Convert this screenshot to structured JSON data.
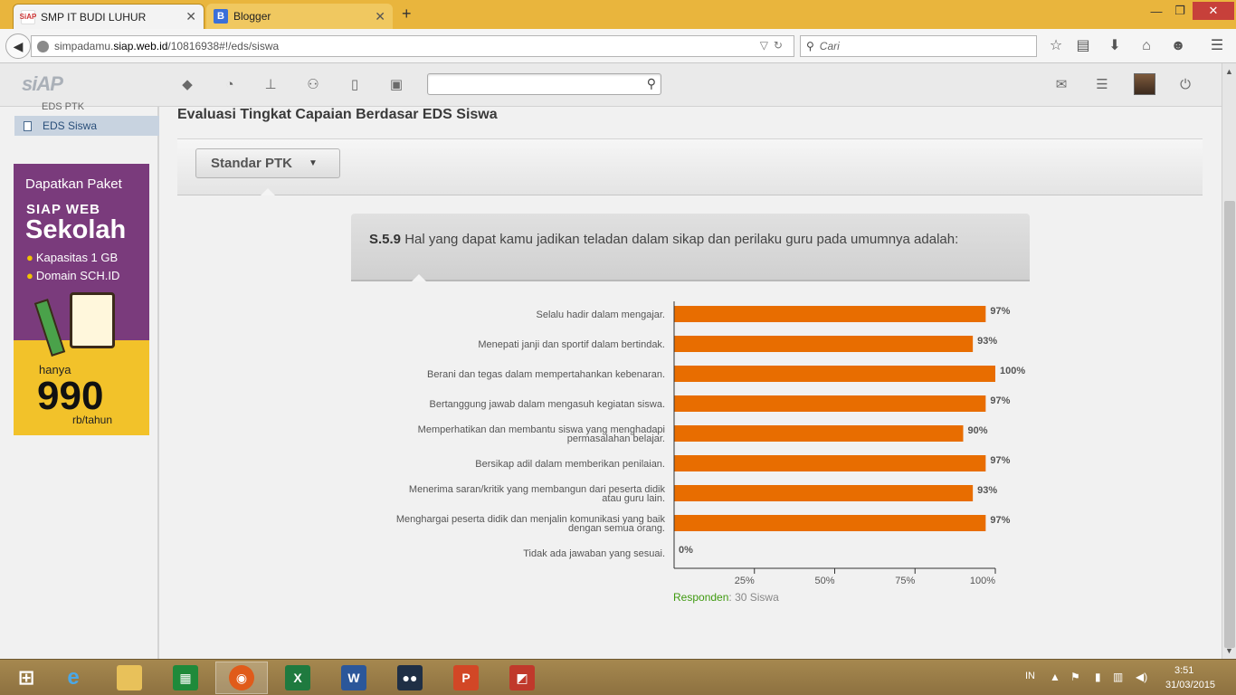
{
  "browser": {
    "tabs": [
      {
        "title": "SMP IT BUDI LUHUR",
        "active": true,
        "favicon": "siap-favicon"
      },
      {
        "title": "Blogger",
        "active": false,
        "favicon": "blogger-favicon"
      }
    ],
    "new_tab": "+",
    "close_glyph": "✕",
    "url_prefix": "simpadamu.",
    "url_domain": "siap.web.id",
    "url_path": "/10816938#!/eds/siswa",
    "search_placeholder": "Cari",
    "accent_color": "#e9b53d"
  },
  "app": {
    "logo": "siAP",
    "header_icons": [
      "cube-icon",
      "rss-icon",
      "sitemap-icon",
      "users-icon",
      "book-icon",
      "contact-card-icon"
    ],
    "search_placeholder": ""
  },
  "sidebar": {
    "prev_item": "EDS PTK",
    "active_item": "EDS Siswa"
  },
  "promo": {
    "line1": "Dapatkan Paket",
    "line2": "SIAP WEB",
    "line3": "Sekolah",
    "bullet1": "Kapasitas 1 GB",
    "bullet2": "Domain SCH.ID",
    "price_prefix": "hanya",
    "price": "990",
    "price_unit": "rb/tahun"
  },
  "main": {
    "title": "Evaluasi Tingkat Capaian Berdasar EDS Siswa",
    "filter_label": "Standar PTK",
    "question_code": "S.5.9",
    "question_text": " Hal yang dapat kamu jadikan teladan dalam sikap dan perilaku guru pada umumnya adalah:",
    "responden_label": "Responden",
    "responden_sep": ":",
    "responden_value": " 30 Siswa"
  },
  "chart_data": {
    "type": "bar",
    "orientation": "horizontal",
    "bar_color": "#e86d00",
    "categories": [
      "Selalu hadir dalam mengajar.",
      "Menepati janji dan sportif dalam bertindak.",
      "Berani dan tegas dalam mempertahankan kebenaran.",
      "Bertanggung jawab dalam mengasuh kegiatan siswa.",
      "Memperhatikan dan membantu siswa yang menghadapi permasalahan belajar.",
      "Bersikap adil dalam memberikan penilaian.",
      "Menerima saran/kritik yang membangun dari peserta didik atau guru lain.",
      "Menghargai peserta didik dan menjalin komunikasi yang baik dengan semua orang.",
      "Tidak ada jawaban yang sesuai."
    ],
    "label_lines": [
      [
        "Selalu hadir dalam mengajar."
      ],
      [
        "Menepati janji dan sportif dalam bertindak."
      ],
      [
        "Berani dan tegas dalam mempertahankan kebenaran."
      ],
      [
        "Bertanggung jawab dalam mengasuh kegiatan siswa."
      ],
      [
        "Memperhatikan dan membantu siswa yang menghadapi",
        "permasalahan belajar."
      ],
      [
        "Bersikap adil dalam memberikan penilaian."
      ],
      [
        "Menerima saran/kritik yang membangun dari peserta didik",
        "atau guru lain."
      ],
      [
        "Menghargai peserta didik dan menjalin komunikasi yang baik",
        "dengan semua orang."
      ],
      [
        "Tidak ada jawaban yang sesuai."
      ]
    ],
    "values": [
      97,
      93,
      100,
      97,
      90,
      97,
      93,
      97,
      0
    ],
    "value_labels": [
      "97%",
      "93%",
      "100%",
      "97%",
      "90%",
      "97%",
      "93%",
      "97%",
      "0%"
    ],
    "xticks": [
      25,
      50,
      75,
      100
    ],
    "xtick_labels": [
      "25%",
      "50%",
      "75%",
      "100%"
    ],
    "xlim": [
      0,
      100
    ],
    "grid": false
  },
  "taskbar": {
    "apps": [
      "start-icon",
      "internet-explorer-icon",
      "file-explorer-icon",
      "store-icon",
      "firefox-icon",
      "excel-icon",
      "word-icon",
      "media-app-icon",
      "ppt-app-icon",
      "office-app-icon"
    ],
    "lang": "IN",
    "time": "3:51",
    "date": "31/03/2015"
  }
}
